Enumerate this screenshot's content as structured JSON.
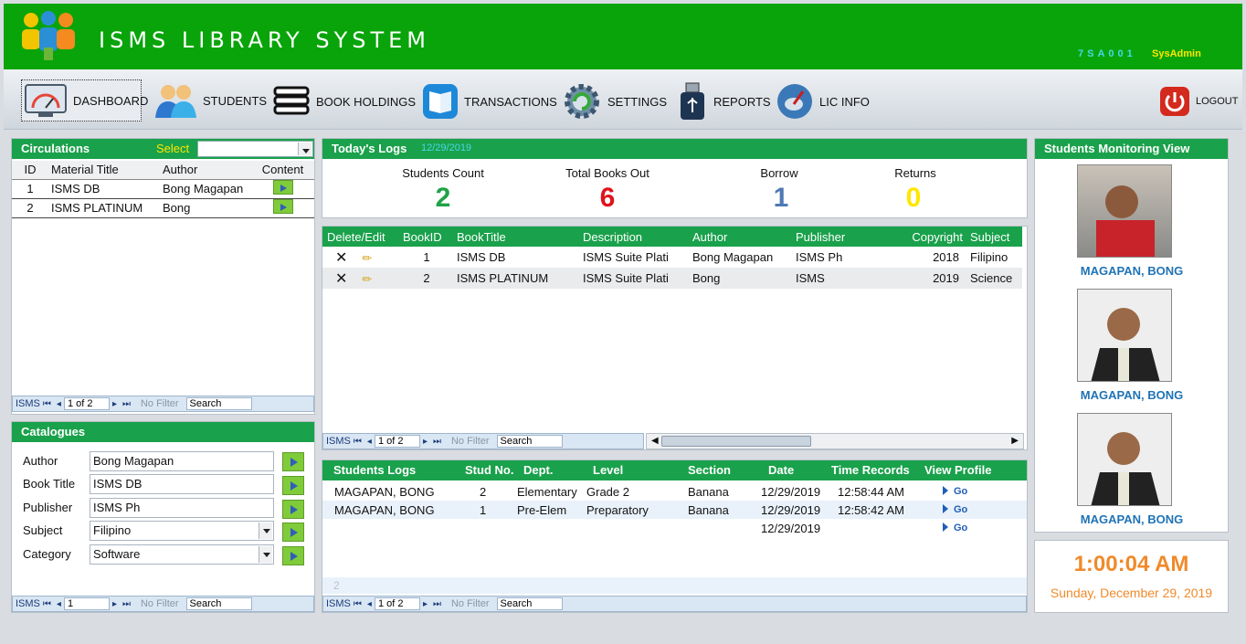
{
  "header": {
    "title": "ISMS LIBRARY SYSTEM",
    "user_code": "7SA001",
    "user_role": "SysAdmin"
  },
  "nav": {
    "dashboard": "DASHBOARD",
    "students": "STUDENTS",
    "book_holdings": "BOOK HOLDINGS",
    "transactions": "TRANSACTIONS",
    "settings": "SETTINGS",
    "reports": "REPORTS",
    "lic_info": "LIC INFO",
    "logout": "LOGOUT"
  },
  "circulations": {
    "title": "Circulations",
    "select_label": "Select",
    "columns": [
      "ID",
      "Material Title",
      "Author",
      "Content"
    ],
    "rows": [
      {
        "id": "1",
        "title": "ISMS DB",
        "author": "Bong Magapan"
      },
      {
        "id": "2",
        "title": "ISMS PLATINUM",
        "author": "Bong"
      }
    ],
    "nav": {
      "label": "ISMS",
      "page": "1 of 2",
      "filter": "No Filter",
      "search": "Search"
    }
  },
  "catalogues": {
    "title": "Catalogues",
    "fields": [
      {
        "label": "Author",
        "value": "Bong Magapan"
      },
      {
        "label": "Book Title",
        "value": "ISMS DB"
      },
      {
        "label": "Publisher",
        "value": "ISMS Ph"
      },
      {
        "label": "Subject",
        "value": "Filipino"
      },
      {
        "label": "Category",
        "value": "Software"
      }
    ],
    "nav": {
      "label": "ISMS",
      "page": "1",
      "filter": "No Filter",
      "search": "Search"
    }
  },
  "todays_logs": {
    "title": "Today's Logs",
    "date": "12/29/2019",
    "stats": [
      {
        "label": "Students Count",
        "value": "2",
        "color": "#1fa347"
      },
      {
        "label": "Total Books Out",
        "value": "6",
        "color": "#e0121b"
      },
      {
        "label": "Borrow",
        "value": "1",
        "color": "#4f7ab4"
      },
      {
        "label": "Returns",
        "value": "0",
        "color": "#ffe600"
      }
    ]
  },
  "books": {
    "columns": [
      "Delete/Edit",
      "BookID",
      "BookTitle",
      "Description",
      "Author",
      "Publisher",
      "Copyright",
      "Subject"
    ],
    "rows": [
      {
        "id": "1",
        "title": "ISMS DB",
        "description": "ISMS Suite Plati",
        "author": "Bong Magapan",
        "publisher": "ISMS Ph",
        "copyright": "2018",
        "subject": "Filipino"
      },
      {
        "id": "2",
        "title": "ISMS PLATINUM",
        "description": "ISMS Suite Plati",
        "author": "Bong",
        "publisher": "ISMS",
        "copyright": "2019",
        "subject": "Science"
      }
    ],
    "nav": {
      "label": "ISMS",
      "page": "1 of 2",
      "filter": "No Filter",
      "search": "Search"
    }
  },
  "students_logs": {
    "title": "Students Logs",
    "columns": [
      "Stud No.",
      "Dept.",
      "Level",
      "Section",
      "Date",
      "Time Records",
      "View Profile"
    ],
    "rows": [
      {
        "name": "MAGAPAN, BONG",
        "stud_no": "2",
        "dept": "Elementary",
        "level": "Grade 2",
        "section": "Banana",
        "date": "12/29/2019",
        "time": "12:58:44 AM",
        "go": "Go"
      },
      {
        "name": "MAGAPAN, BONG",
        "stud_no": "1",
        "dept": "Pre-Elem",
        "level": "Preparatory",
        "section": "Banana",
        "date": "12/29/2019",
        "time": "12:58:42 AM",
        "go": "Go"
      },
      {
        "name": "",
        "stud_no": "",
        "dept": "",
        "level": "",
        "section": "",
        "date": "12/29/2019",
        "time": "",
        "go": "Go"
      }
    ],
    "footer_count": "2",
    "nav": {
      "label": "ISMS",
      "page": "1 of 2",
      "filter": "No Filter",
      "search": "Search"
    }
  },
  "monitoring": {
    "title": "Students Monitoring View",
    "students": [
      {
        "name": "MAGAPAN, BONG"
      },
      {
        "name": "MAGAPAN, BONG"
      },
      {
        "name": "MAGAPAN, BONG"
      }
    ]
  },
  "clock": {
    "time": "1:00:04 AM",
    "date": "Sunday, December 29, 2019"
  }
}
